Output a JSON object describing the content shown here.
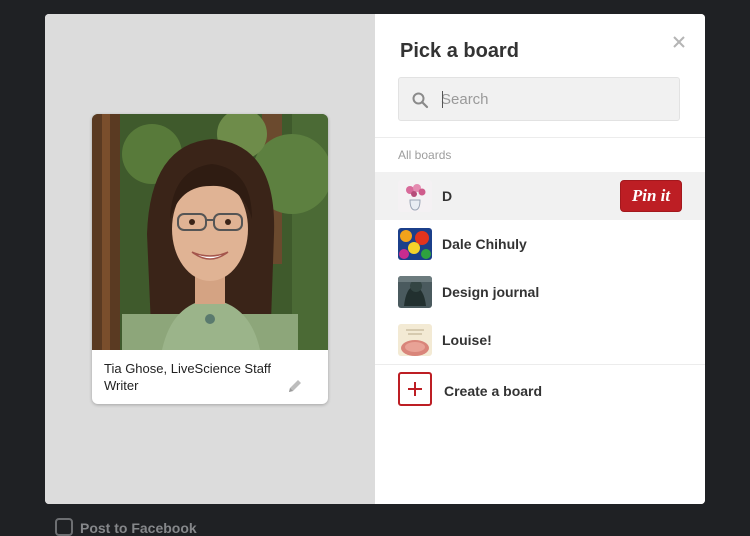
{
  "pin": {
    "description": "Tia Ghose, LiveScience Staff Writer"
  },
  "picker": {
    "title": "Pick a board",
    "search": {
      "placeholder": "Search",
      "value": ""
    },
    "section_label": "All boards",
    "boards": [
      {
        "name": "D",
        "selected": true,
        "action_label": "Pin it"
      },
      {
        "name": "Dale Chihuly"
      },
      {
        "name": "Design journal"
      },
      {
        "name": "Louise!"
      }
    ],
    "create_label": "Create a board"
  },
  "footer": {
    "post_to_facebook_label": "Post to Facebook",
    "post_to_facebook_checked": false
  },
  "colors": {
    "accent": "#bd1e24",
    "page_background": "#1f2124",
    "left_pane": "#dcdcdc"
  }
}
